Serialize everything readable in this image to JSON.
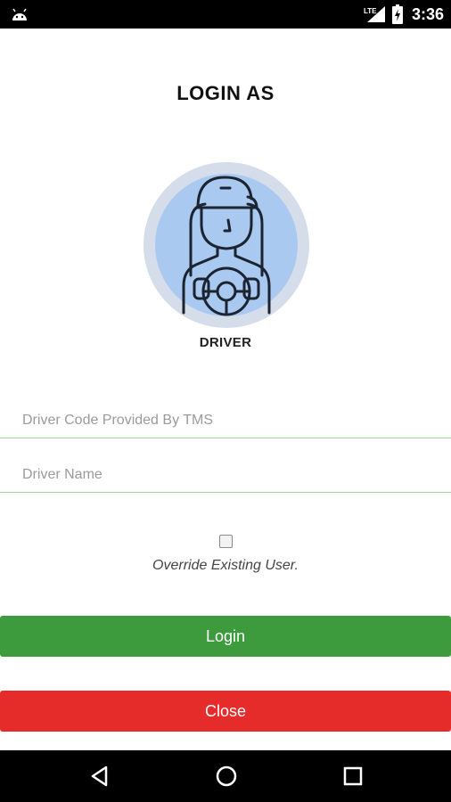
{
  "status_bar": {
    "time": "3:36",
    "network": "LTE",
    "icons": [
      "android-icon",
      "signal-icon",
      "battery-charging-icon"
    ]
  },
  "screen": {
    "title": "LOGIN AS",
    "role_label": "DRIVER",
    "avatar_icon": "driver-steering-wheel-icon"
  },
  "form": {
    "driver_code_placeholder": "Driver Code Provided By TMS",
    "driver_code_value": "",
    "driver_name_placeholder": "Driver Name",
    "driver_name_value": "",
    "override_label": "Override Existing User.",
    "override_checked": false
  },
  "buttons": {
    "login_label": "Login",
    "close_label": "Close"
  },
  "nav": {
    "icons": [
      "back-icon",
      "home-icon",
      "recents-icon"
    ]
  },
  "colors": {
    "login_button": "#3d9a3d",
    "close_button": "#e62b2b",
    "field_underline": "#9fd89a",
    "avatar_ring": "#d4dde9",
    "avatar_fill": "#a9c9f0"
  }
}
